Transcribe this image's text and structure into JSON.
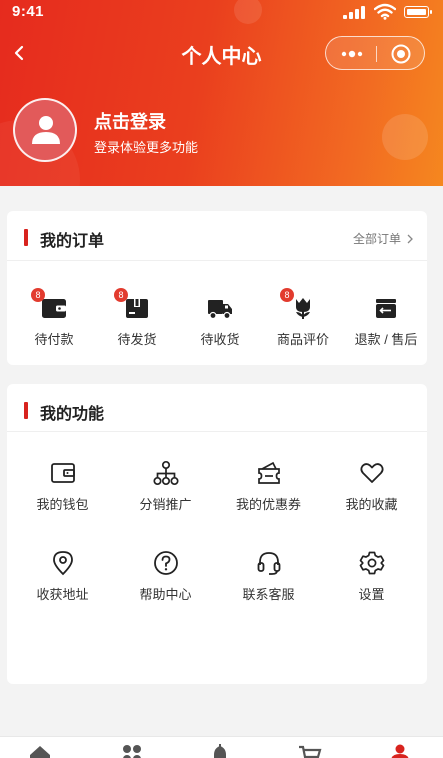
{
  "status_bar": {
    "time": "9:41"
  },
  "header": {
    "title": "个人中心"
  },
  "profile": {
    "login_title": "点击登录",
    "login_subtitle": "登录体验更多功能"
  },
  "orders": {
    "title": "我的订单",
    "all_link": "全部订单",
    "items": [
      {
        "label": "待付款",
        "icon": "wallet-icon",
        "badge": "8"
      },
      {
        "label": "待发货",
        "icon": "package-icon",
        "badge": "8"
      },
      {
        "label": "待收货",
        "icon": "truck-icon"
      },
      {
        "label": "商品评价",
        "icon": "flower-icon",
        "badge": "8"
      },
      {
        "label": "退款 / 售后",
        "icon": "refund-icon"
      }
    ]
  },
  "functions": {
    "title": "我的功能",
    "items": [
      {
        "label": "我的钱包",
        "icon": "wallet-outline-icon"
      },
      {
        "label": "分销推广",
        "icon": "network-icon"
      },
      {
        "label": "我的优惠券",
        "icon": "coupon-icon"
      },
      {
        "label": "我的收藏",
        "icon": "heart-icon"
      },
      {
        "label": "收获地址",
        "icon": "location-icon"
      },
      {
        "label": "帮助中心",
        "icon": "help-icon"
      },
      {
        "label": "联系客服",
        "icon": "headset-icon"
      },
      {
        "label": "设置",
        "icon": "settings-icon"
      }
    ]
  },
  "tabbar": {
    "items": [
      "home-icon",
      "category-icon",
      "bell-icon",
      "cart-icon",
      "profile-icon"
    ],
    "active_index": 4
  },
  "colors": {
    "accent": "#d8231e",
    "header_start": "#e62b1e",
    "header_end": "#f5871f",
    "badge": "#e23b2e"
  }
}
